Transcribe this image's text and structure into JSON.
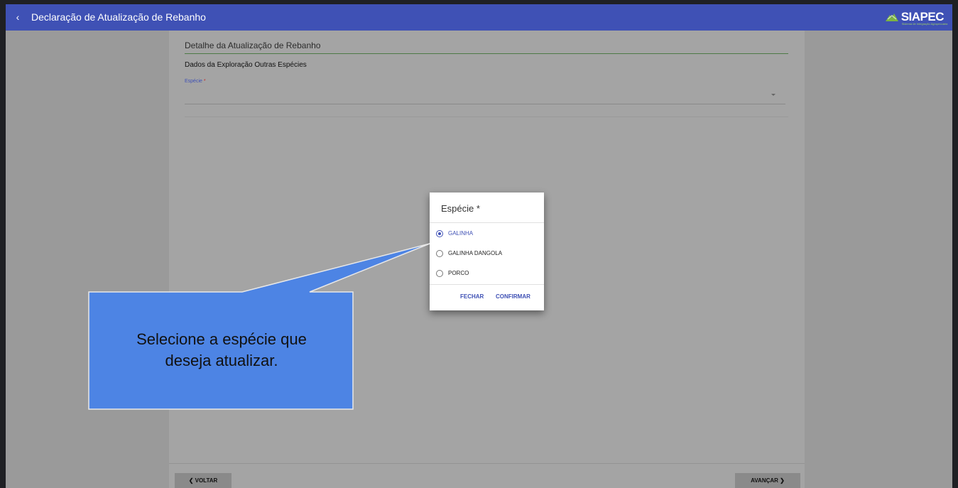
{
  "appbar": {
    "back_icon": "chevron-left-icon",
    "title": "Declaração de Atualização de Rebanho",
    "logo_text": "SIAPEC",
    "logo_subtext": "Sistema de Integração Agropecuária"
  },
  "card": {
    "title": "Detalhe da Atualização de Rebanho",
    "section_title": "Dados da Exploração Outras Espécies",
    "field_label": "Espécie",
    "required_mark": "*",
    "selected_value": ""
  },
  "footer": {
    "back_label": "❮ VOLTAR",
    "next_label": "AVANÇAR ❯"
  },
  "dialog": {
    "title": "Espécie *",
    "options": [
      {
        "label": "GALINHA",
        "selected": true
      },
      {
        "label": "GALINHA DANGOLA",
        "selected": false
      },
      {
        "label": "PORCO",
        "selected": false
      }
    ],
    "close_label": "FECHAR",
    "confirm_label": "CONFIRMAR"
  },
  "callout": {
    "text_line1": "Selecione a espécie que",
    "text_line2": "deseja atualizar."
  },
  "colors": {
    "primary": "#3f51b5",
    "callout_fill": "#4d84e4",
    "accent_green": "#9ccc65"
  }
}
